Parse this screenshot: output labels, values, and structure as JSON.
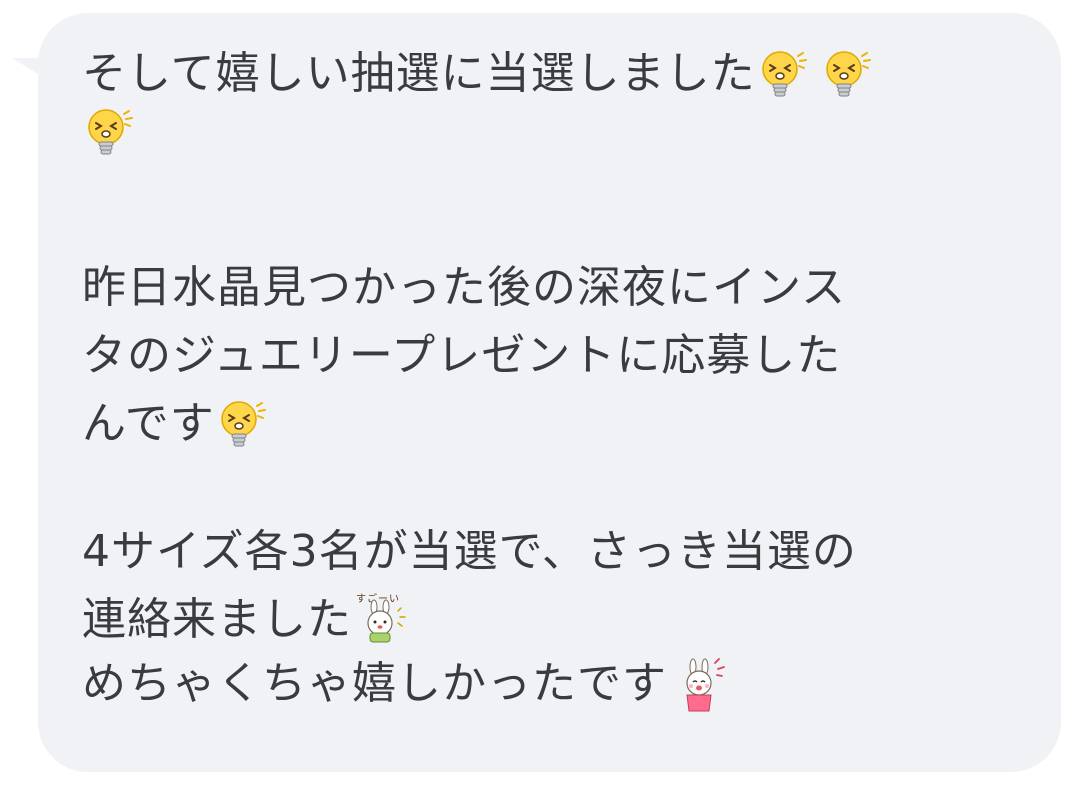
{
  "message": {
    "paragraph1": {
      "line1": "そして嬉しい抽選に当選しました",
      "emojis_line1": [
        "bulb-face-icon",
        "bulb-face-icon"
      ],
      "emojis_line2": [
        "bulb-face-icon"
      ]
    },
    "paragraph2": {
      "line1": "昨日水晶見つかった後の深夜にインス",
      "line2": "タのジュエリープレゼントに応募した",
      "line3": "んです",
      "emojis_line3": [
        "bulb-face-icon"
      ]
    },
    "paragraph3": {
      "line1": "4サイズ各3名が当選で、さっき当選の",
      "line2": "連絡来ました",
      "stamp_line2": "rabbit-sugoi-icon",
      "stamp_text": "すごーい",
      "line3": "めちゃくちゃ嬉しかったです",
      "stamp_line3": "rabbit-happy-icon"
    }
  },
  "colors": {
    "bubble_background": "#f1f2f5",
    "text": "#3a3b3f",
    "bulb_yellow": "#ffd54a",
    "bulb_base": "#9aa0a6",
    "rabbit_pink": "#ff6b8a"
  }
}
